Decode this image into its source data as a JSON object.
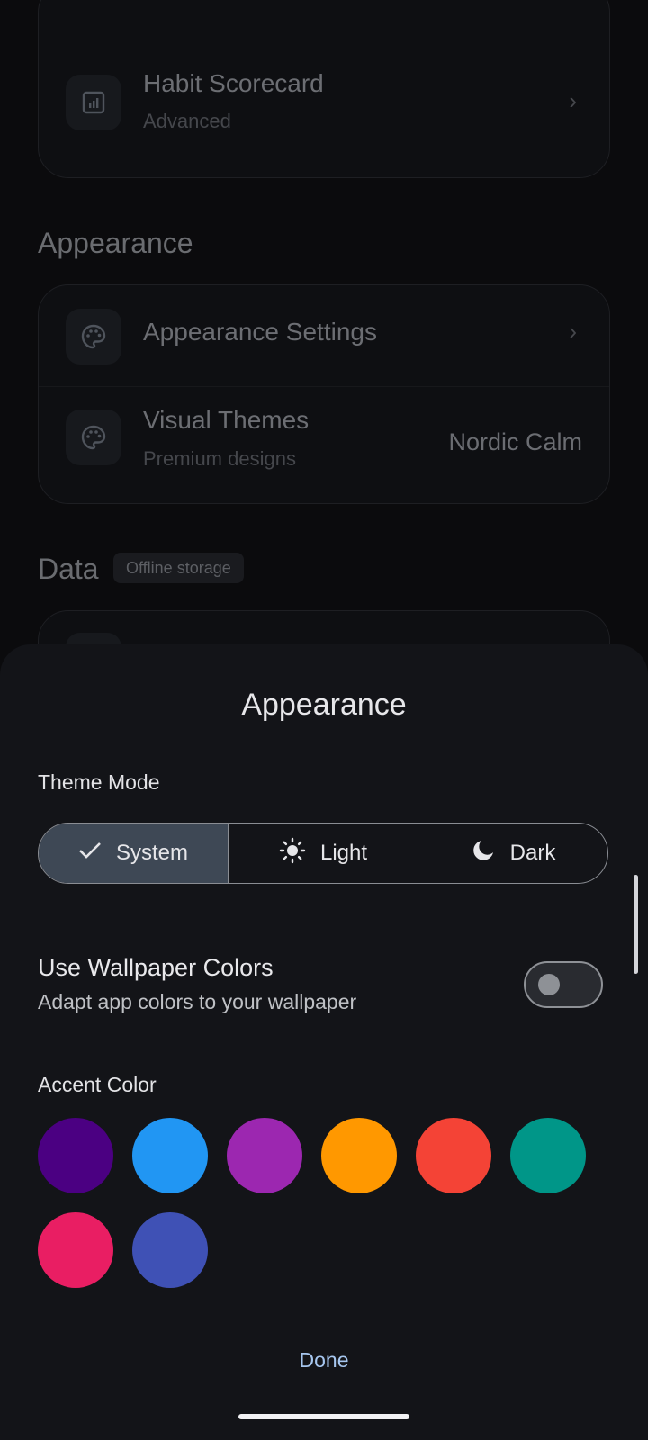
{
  "background": {
    "rows": {
      "habit_scorecard": {
        "title": "Habit Scorecard",
        "subtitle": "Advanced",
        "icon": "chart-icon"
      },
      "appearance_settings": {
        "title": "Appearance Settings",
        "icon": "palette-icon"
      },
      "visual_themes": {
        "title": "Visual Themes",
        "subtitle": "Premium designs",
        "value": "Nordic Calm",
        "icon": "palette-icon"
      }
    },
    "sections": {
      "appearance": "Appearance",
      "data": "Data",
      "data_badge": "Offline storage"
    }
  },
  "sheet": {
    "title": "Appearance",
    "theme_mode": {
      "label": "Theme Mode",
      "options": [
        {
          "label": "System",
          "icon": "check-icon",
          "selected": true
        },
        {
          "label": "Light",
          "icon": "sun-icon",
          "selected": false
        },
        {
          "label": "Dark",
          "icon": "moon-icon",
          "selected": false
        }
      ]
    },
    "wallpaper": {
      "title": "Use Wallpaper Colors",
      "subtitle": "Adapt app colors to your wallpaper",
      "enabled": false
    },
    "accent": {
      "label": "Accent Color",
      "colors": [
        "#4B0082",
        "#2196F3",
        "#9C27B0",
        "#FF9800",
        "#F44336",
        "#009688",
        "#E91E63",
        "#3F51B5"
      ]
    },
    "done_label": "Done"
  }
}
